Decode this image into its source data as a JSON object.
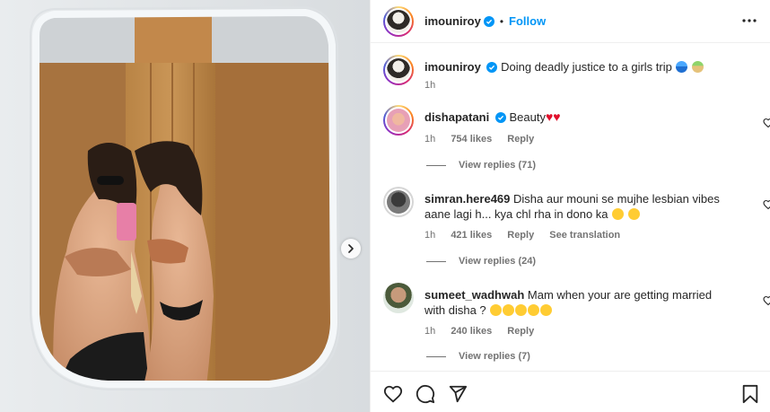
{
  "post": {
    "author": "imouniroy",
    "follow_label": "Follow",
    "separator": "•",
    "caption": {
      "username": "imouniroy",
      "text": "Doing deadly justice to a girls trip",
      "time": "1h"
    }
  },
  "comments": [
    {
      "username": "dishapatani",
      "verified": true,
      "text": "Beauty",
      "time": "1h",
      "likes": "754 likes",
      "reply_label": "Reply",
      "view_replies": "View replies (71)"
    },
    {
      "username": "simran.here469",
      "verified": false,
      "text": "Disha aur mouni se mujhe lesbian vibes aane lagi h... kya chl rha in dono ka",
      "time": "1h",
      "likes": "421 likes",
      "reply_label": "Reply",
      "translation_label": "See translation",
      "view_replies": "View replies (24)"
    },
    {
      "username": "sumeet_wadhwah",
      "verified": false,
      "text": "Mam when your are getting married with disha ?",
      "time": "1h",
      "likes": "240 likes",
      "reply_label": "Reply",
      "view_replies": "View replies (7)"
    }
  ],
  "icons": {
    "like": "heart-icon",
    "comment": "comment-icon",
    "share": "share-icon",
    "save": "bookmark-icon",
    "more": "more-options-icon",
    "next": "chevron-right-icon"
  },
  "colors": {
    "accent": "#0095f6",
    "heart_emoji": "#e0102c",
    "verified": "#0095f6",
    "text": "#262626",
    "muted": "#737373"
  }
}
